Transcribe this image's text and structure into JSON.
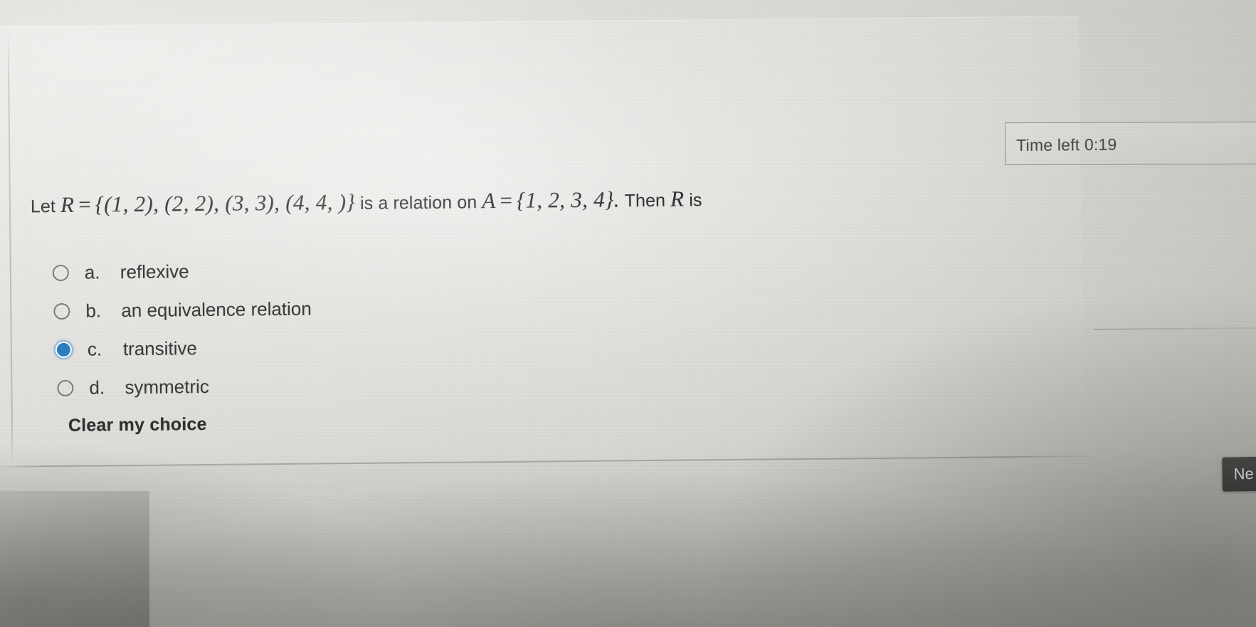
{
  "quiz": {
    "question": {
      "prefix": "Let",
      "relation_symbol": "R",
      "equals": "=",
      "relation_set": "{(1, 2), (2, 2), (3, 3), (4, 4, )}",
      "middle_text": "is a relation on",
      "set_symbol": "A",
      "set_value": "{1, 2, 3, 4}.",
      "suffix_text": "Then",
      "suffix_symbol": "R",
      "suffix_tail": "is",
      "full_text": "Let R = {(1,2),(2,2),(3,3),(4,4,)} is a relation on A = {1,2,3,4}. Then R is"
    },
    "options": [
      {
        "letter": "a.",
        "label": "reflexive",
        "selected": false
      },
      {
        "letter": "b.",
        "label": "an equivalence relation",
        "selected": false
      },
      {
        "letter": "c.",
        "label": "transitive",
        "selected": true
      },
      {
        "letter": "d.",
        "label": "symmetric",
        "selected": false
      }
    ],
    "clear_choice_label": "Clear my choice",
    "timer": {
      "label": "Time left 0:19"
    },
    "next_button_label": "Ne"
  },
  "colors": {
    "selected_radio": "#2c7fbe",
    "radio_border": "#7d7b78",
    "text": "#3a3a3a",
    "next_button_bg": "#3f3f3d"
  }
}
